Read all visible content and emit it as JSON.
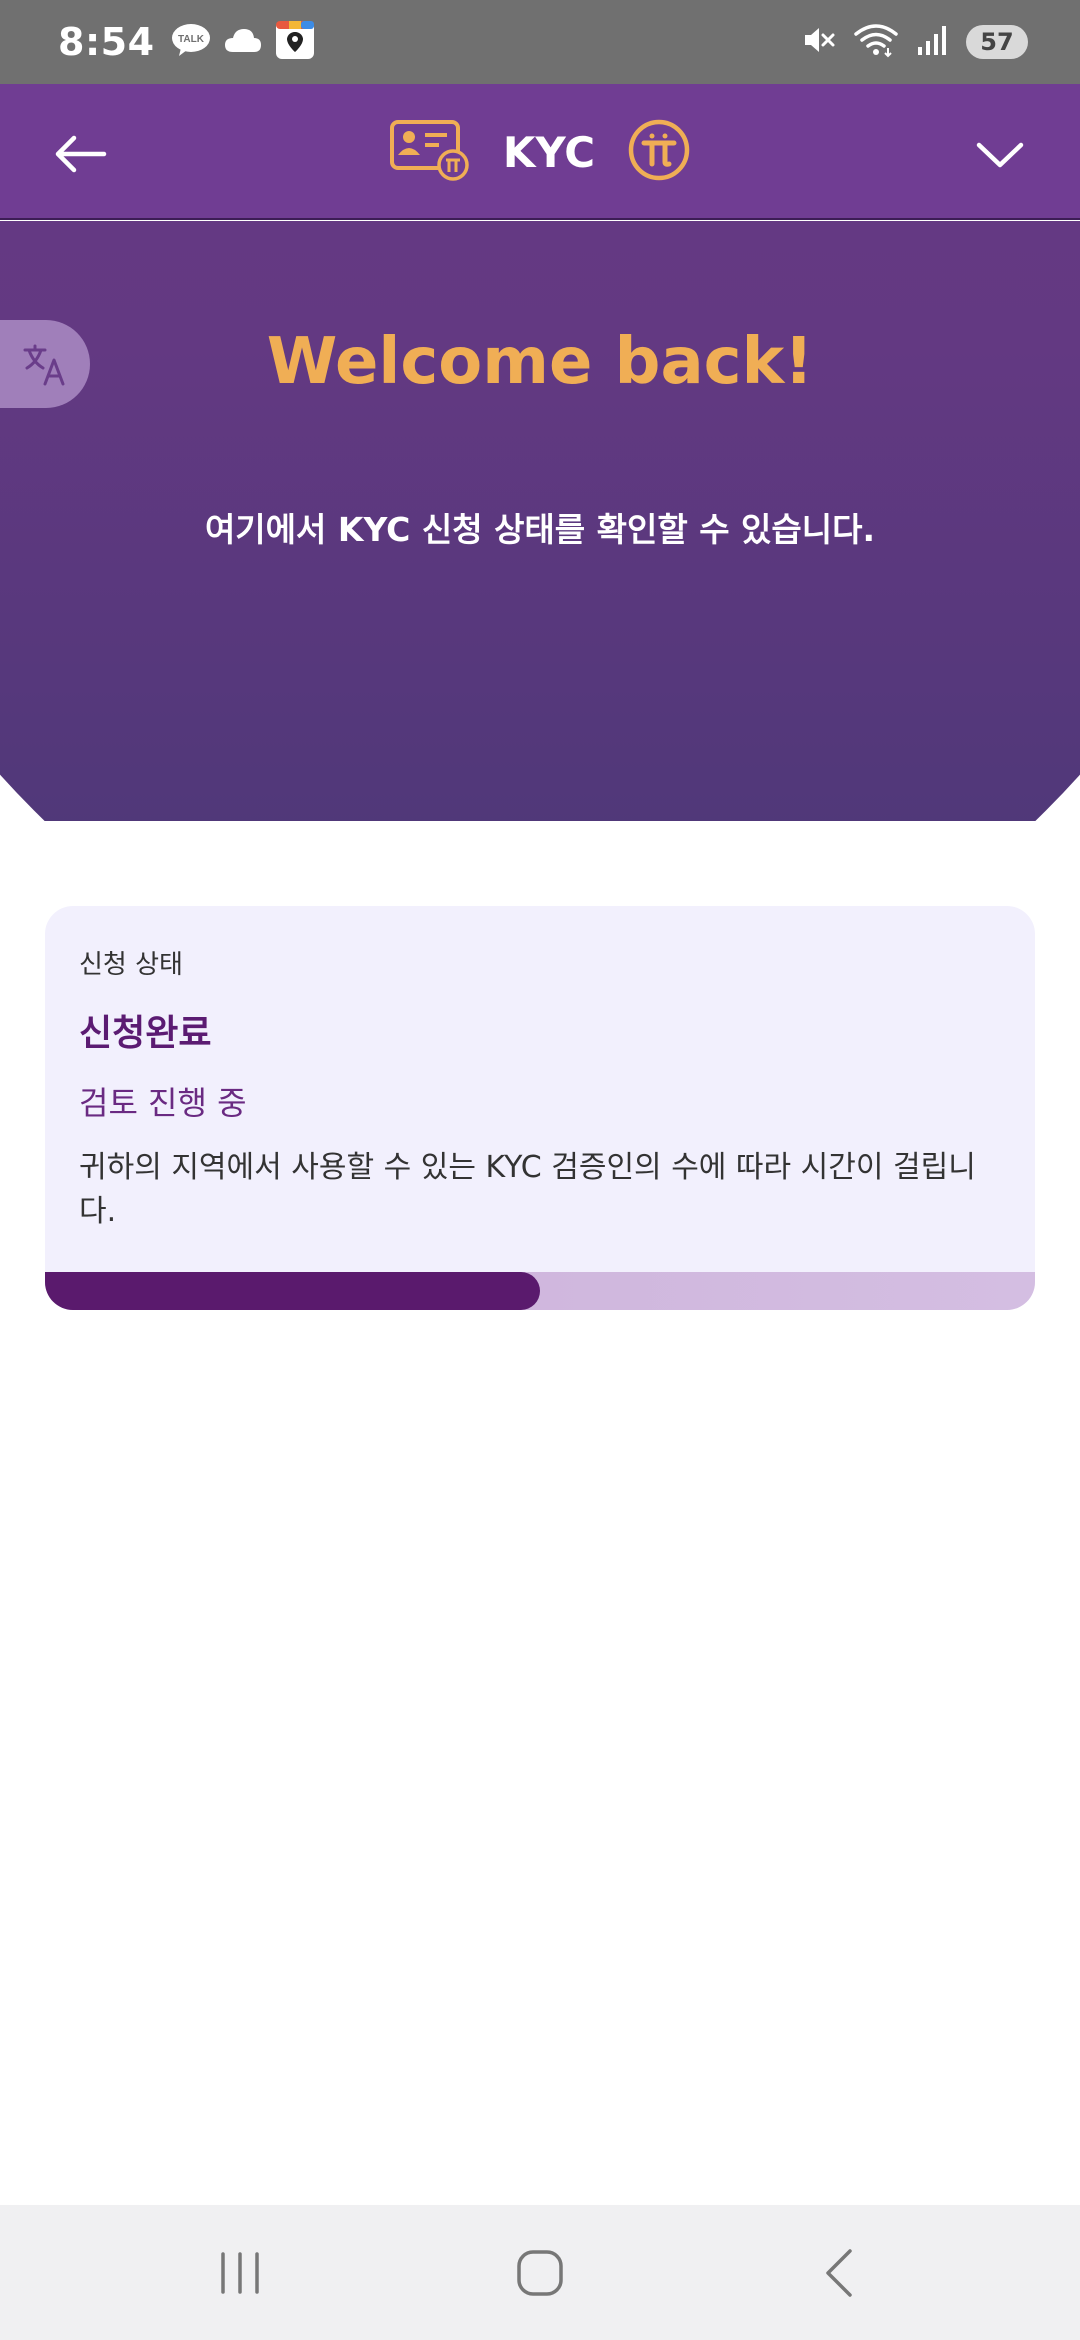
{
  "status_bar": {
    "time": "8:54",
    "battery": "57",
    "icons": [
      "kakaotalk-icon",
      "cloud-icon",
      "calendar-app-icon",
      "mute-icon",
      "wifi-icon",
      "signal-icon",
      "battery-icon"
    ]
  },
  "header": {
    "title": "KYC",
    "back_icon": "arrow-left-icon",
    "left_badge_icon": "id-card-pi-icon",
    "right_badge_icon": "pi-coin-icon",
    "expand_icon": "chevron-down-icon"
  },
  "hero": {
    "title": "Welcome back!",
    "subtitle": "여기에서 KYC 신청 상태를 확인할 수 있습니다.",
    "translate_icon": "translate-icon"
  },
  "status_card": {
    "label": "신청 상태",
    "status": "신청완료",
    "review": "검토 진행 중",
    "description": "귀하의 지역에서 사용할 수 있는 KYC 검증인의 수에 따라 시간이 걸립니다.",
    "progress_fraction": 0.5
  },
  "nav": {
    "icons": [
      "recent-apps-icon",
      "home-icon",
      "back-icon"
    ]
  },
  "colors": {
    "header_bg": "#703d93",
    "accent_gold": "#f0ae55",
    "hero_bottom": "#483775",
    "card_bg": "#f2f0fd",
    "status_purple": "#5b1b72",
    "progress_fill": "#5a1a6d",
    "progress_track": "#cbb0d9"
  }
}
